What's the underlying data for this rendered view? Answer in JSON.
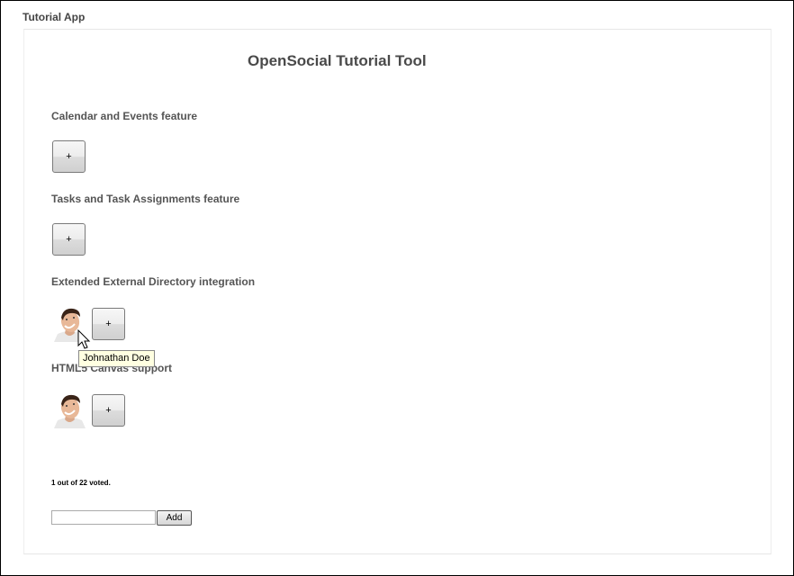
{
  "app_title": "Tutorial App",
  "tool_title": "OpenSocial Tutorial Tool",
  "features": [
    {
      "title": "Calendar and Events feature",
      "button_label": "+"
    },
    {
      "title": "Tasks and Task Assignments feature",
      "button_label": "+"
    },
    {
      "title": "Extended External Directory integration",
      "button_label": "+"
    },
    {
      "title": "HTML5 Canvas support",
      "button_label": "+"
    }
  ],
  "tooltip": "Johnathan Doe",
  "vote_status": "1 out of 22 voted.",
  "add_form": {
    "input_value": "",
    "button_label": "Add"
  }
}
